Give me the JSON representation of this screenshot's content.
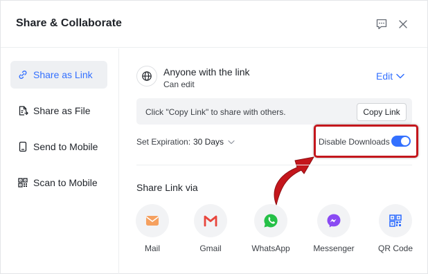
{
  "dialog": {
    "title": "Share & Collaborate",
    "feedback_icon": "feedback-icon",
    "close_icon": "close-icon"
  },
  "sidebar": {
    "items": [
      {
        "label": "Share as Link",
        "icon": "link-icon",
        "active": true
      },
      {
        "label": "Share as File",
        "icon": "file-export-icon",
        "active": false
      },
      {
        "label": "Send to Mobile",
        "icon": "mobile-icon",
        "active": false
      },
      {
        "label": "Scan to Mobile",
        "icon": "qr-code-icon",
        "active": false
      }
    ]
  },
  "permission": {
    "icon": "globe-icon",
    "title": "Anyone with the link",
    "subtitle": "Can edit",
    "edit_label": "Edit"
  },
  "link": {
    "hint": "Click \"Copy Link\" to share with others.",
    "copy_label": "Copy Link"
  },
  "expiration": {
    "label": "Set Expiration:",
    "value": "30 Days"
  },
  "downloads": {
    "label": "Disable Downloads",
    "enabled": true
  },
  "share_via": {
    "title": "Share Link via",
    "options": [
      {
        "label": "Mail",
        "icon": "mail-icon"
      },
      {
        "label": "Gmail",
        "icon": "gmail-icon"
      },
      {
        "label": "WhatsApp",
        "icon": "whatsapp-icon"
      },
      {
        "label": "Messenger",
        "icon": "messenger-icon"
      },
      {
        "label": "QR Code",
        "icon": "qr-code-icon"
      }
    ]
  },
  "colors": {
    "accent": "#3370ff",
    "highlight_border": "#c4161c",
    "arrow": "#c4161c"
  }
}
